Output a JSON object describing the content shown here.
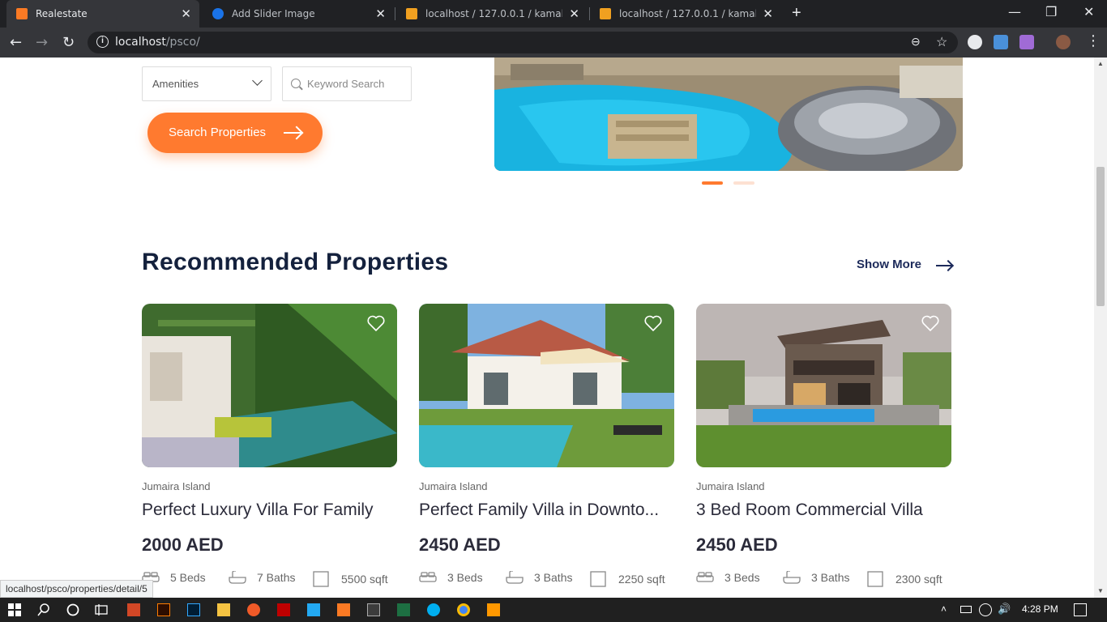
{
  "browser": {
    "tabs": [
      {
        "title": "Realestate",
        "active": true
      },
      {
        "title": "Add Slider Image",
        "active": false
      },
      {
        "title": "localhost / 127.0.0.1 / kamal / cat",
        "active": false
      },
      {
        "title": "localhost / 127.0.0.1 / kamal / cat",
        "active": false
      }
    ],
    "url_host": "localhost",
    "url_path": "/psco/"
  },
  "search": {
    "amenities_label": "Amenities",
    "keyword_placeholder": "Keyword Search",
    "button_label": "Search Properties"
  },
  "recommended": {
    "title": "Recommended Properties",
    "show_more": "Show More",
    "cards": [
      {
        "location": "Jumaira Island",
        "name": "Perfect Luxury Villa For Family",
        "price": "2000 AED",
        "beds": "5 Beds",
        "baths": "7 Baths",
        "area": "5500 sqft"
      },
      {
        "location": "Jumaira Island",
        "name": "Perfect Family Villa in Downto...",
        "price": "2450 AED",
        "beds": "3 Beds",
        "baths": "3 Baths",
        "area": "2250 sqft"
      },
      {
        "location": "Jumaira Island",
        "name": "3 Bed Room Commercial Villa",
        "price": "2450 AED",
        "beds": "3 Beds",
        "baths": "3 Baths",
        "area": "2300 sqft"
      }
    ]
  },
  "status_bar": "localhost/psco/properties/detail/5",
  "taskbar": {
    "time": "4:28 PM"
  },
  "colors": {
    "accent": "#ff7a2f",
    "heading": "#14213d",
    "link": "#1c2a5a"
  }
}
